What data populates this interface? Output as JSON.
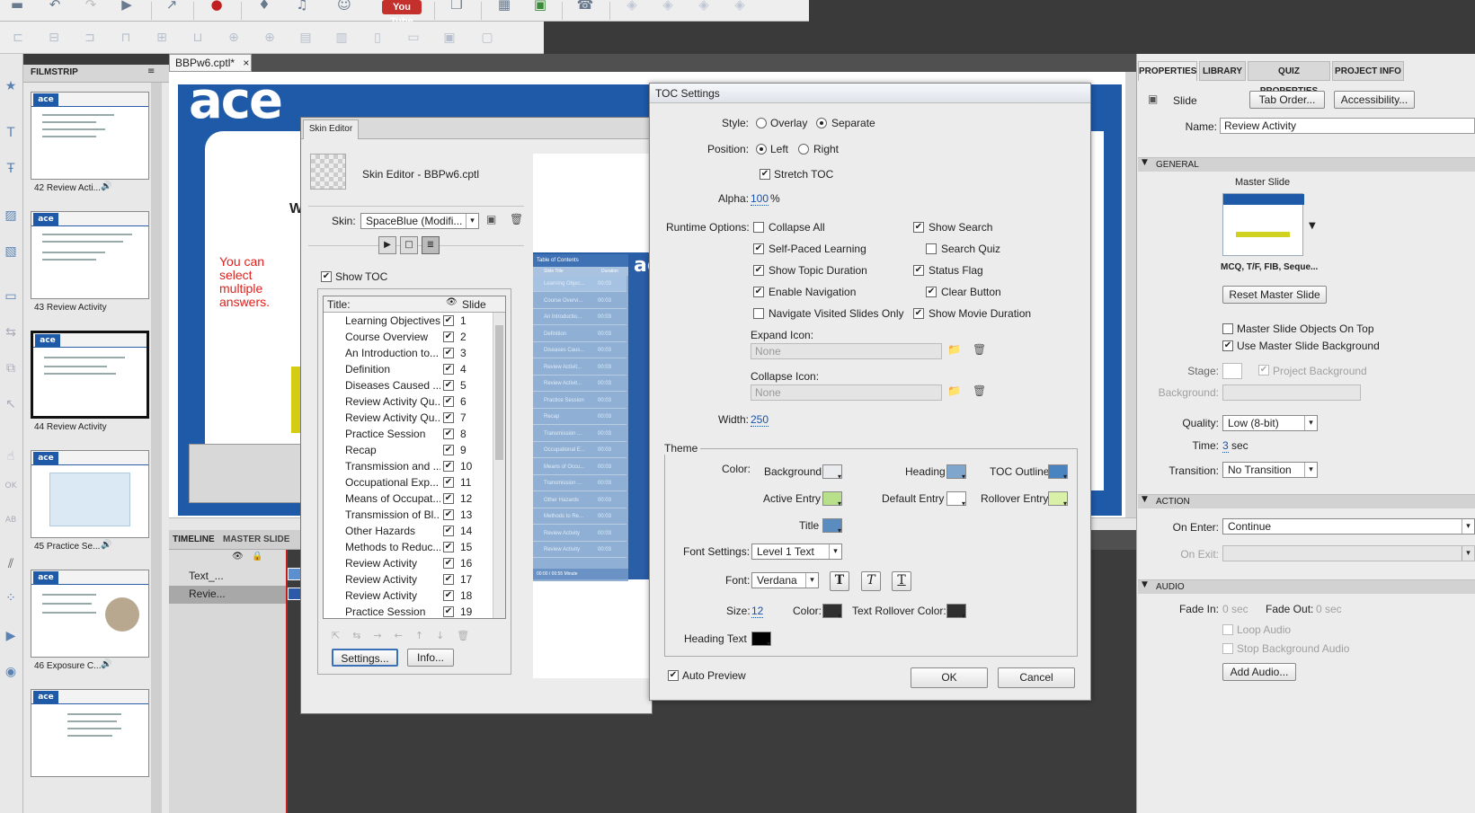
{
  "toolbar": {
    "youtube_label": "You Tube"
  },
  "document": {
    "tab_label": "BBPw6.cptl*",
    "tab_close": "×"
  },
  "filmstrip": {
    "header": "FILMSTRIP",
    "logo": "ace",
    "slides": [
      {
        "label": "42 Review Acti...",
        "audio": "🔊"
      },
      {
        "label": "43 Review Activity",
        "audio": ""
      },
      {
        "label": "44 Review Activity",
        "audio": ""
      },
      {
        "label": "45 Practice Se...",
        "audio": "🔊"
      },
      {
        "label": "46 Exposure C...",
        "audio": "🔊"
      }
    ]
  },
  "stage": {
    "logo": "ace",
    "side_text": "You can select multiple answers.",
    "partial_letter": "W"
  },
  "timeline": {
    "tabs": [
      "TIMELINE",
      "MASTER SLIDE"
    ],
    "rows": [
      "Text_...",
      "Revie..."
    ]
  },
  "skin_editor": {
    "tab": "Skin Editor",
    "title": "Skin Editor - BBPw6.cptl",
    "skin_label": "Skin:",
    "skin_value": "SpaceBlue (Modifi...",
    "show_toc": "Show TOC",
    "col_title": "Title:",
    "col_slide": "Slide",
    "rows": [
      {
        "title": "Learning Objectives",
        "slide": "1"
      },
      {
        "title": "Course Overview",
        "slide": "2"
      },
      {
        "title": "An Introduction to...",
        "slide": "3"
      },
      {
        "title": "Definition",
        "slide": "4"
      },
      {
        "title": "Diseases Caused ...",
        "slide": "5"
      },
      {
        "title": "Review Activity Qu...",
        "slide": "6"
      },
      {
        "title": "Review Activity Qu...",
        "slide": "7"
      },
      {
        "title": "Practice Session",
        "slide": "8"
      },
      {
        "title": "Recap",
        "slide": "9"
      },
      {
        "title": "Transmission and ...",
        "slide": "10"
      },
      {
        "title": "Occupational Exp...",
        "slide": "11"
      },
      {
        "title": "Means of Occupat...",
        "slide": "12"
      },
      {
        "title": "Transmission of Bl...",
        "slide": "13"
      },
      {
        "title": "Other Hazards",
        "slide": "14"
      },
      {
        "title": "Methods to Reduc...",
        "slide": "15"
      },
      {
        "title": "Review Activity",
        "slide": "16"
      },
      {
        "title": "Review Activity",
        "slide": "17"
      },
      {
        "title": "Review Activity",
        "slide": "18"
      },
      {
        "title": "Practice Session",
        "slide": "19"
      }
    ],
    "settings_button": "Settings...",
    "info_button": "Info..."
  },
  "preview": {
    "header": "Table of Contents",
    "col_title": "Slide Title",
    "col_duration": "Duration",
    "rows": [
      {
        "t": "Learning Objec...",
        "d": "00:03"
      },
      {
        "t": "Course Overvi...",
        "d": "00:03"
      },
      {
        "t": "An Introductio...",
        "d": "00:03"
      },
      {
        "t": "Definition",
        "d": "00:03"
      },
      {
        "t": "Diseases Caus...",
        "d": "00:03"
      },
      {
        "t": "Review Activit...",
        "d": "00:03"
      },
      {
        "t": "Review Activit...",
        "d": "00:03"
      },
      {
        "t": "Practice Session",
        "d": "00:03"
      },
      {
        "t": "Recap",
        "d": "00:03"
      },
      {
        "t": "Transmission ...",
        "d": "00:03"
      },
      {
        "t": "Occupational E...",
        "d": "00:03"
      },
      {
        "t": "Means of Occu...",
        "d": "00:03"
      },
      {
        "t": "Transmission ...",
        "d": "00:03"
      },
      {
        "t": "Other Hazards",
        "d": "00:03"
      },
      {
        "t": "Methods to Re...",
        "d": "00:03"
      },
      {
        "t": "Review Activity",
        "d": "00:03"
      },
      {
        "t": "Review Activity",
        "d": "00:03"
      }
    ],
    "footer": "00:00 / 00:55 Minute",
    "logo": "ac"
  },
  "toc_settings": {
    "title": "TOC Settings",
    "style_label": "Style:",
    "style_overlay": "Overlay",
    "style_separate": "Separate",
    "position_label": "Position:",
    "position_left": "Left",
    "position_right": "Right",
    "stretch_toc": "Stretch TOC",
    "alpha_label": "Alpha:",
    "alpha_value": "100",
    "alpha_unit": "%",
    "runtime_label": "Runtime Options:",
    "opt_collapse_all": "Collapse All",
    "opt_self_paced": "Self-Paced Learning",
    "opt_topic_duration": "Show Topic Duration",
    "opt_enable_nav": "Enable Navigation",
    "opt_nav_visited": "Navigate Visited Slides Only",
    "opt_show_search": "Show Search",
    "opt_search_quiz": "Search Quiz",
    "opt_status_flag": "Status Flag",
    "opt_clear_button": "Clear Button",
    "opt_movie_duration": "Show Movie Duration",
    "expand_icon_label": "Expand Icon:",
    "expand_icon_value": "None",
    "collapse_icon_label": "Collapse Icon:",
    "collapse_icon_value": "None",
    "width_label": "Width:",
    "width_value": "250",
    "theme_label": "Theme",
    "color_label": "Color:",
    "c_background": "Background",
    "c_heading": "Heading",
    "c_toc_outline": "TOC Outline",
    "c_active_entry": "Active Entry",
    "c_default_entry": "Default Entry",
    "c_rollover_entry": "Rollover Entry",
    "c_title": "Title",
    "font_settings_label": "Font Settings:",
    "font_settings_value": "Level 1 Text",
    "font_label": "Font:",
    "font_value": "Verdana",
    "size_label": "Size:",
    "size_value": "12",
    "font_color_label": "Color:",
    "text_rollover_label": "Text Rollover Color:",
    "heading_text_label": "Heading Text",
    "auto_preview": "Auto Preview",
    "ok": "OK",
    "cancel": "Cancel",
    "style_b": "T",
    "style_i": "T",
    "style_u": "T"
  },
  "colors": {
    "background": "#e9ebee",
    "heading": "#7fa6cc",
    "toc_outline": "#4a84c0",
    "active_entry": "#b8e08a",
    "default_entry": "#ffffff",
    "rollover_entry": "#d8f0a8",
    "title": "#5b8cc0",
    "font_color": "#303030",
    "text_rollover": "#303030",
    "heading_text": "#000000",
    "brand_blue": "#1e5aa8"
  },
  "properties": {
    "tabs": [
      "PROPERTIES",
      "LIBRARY",
      "QUIZ PROPERTIES",
      "PROJECT INFO"
    ],
    "slide_label": "Slide",
    "tab_order_button": "Tab Order...",
    "accessibility_button": "Accessibility...",
    "name_label": "Name:",
    "name_value": "Review Activity",
    "general_header": "GENERAL",
    "master_slide_label": "Master Slide",
    "master_slide_name": "MCQ, T/F, FIB, Seque...",
    "reset_master_button": "Reset Master Slide",
    "master_objects_on_top": "Master Slide Objects On Top",
    "use_master_background": "Use Master Slide Background",
    "stage_label": "Stage:",
    "project_background": "Project Background",
    "background_label": "Background:",
    "quality_label": "Quality:",
    "quality_value": "Low (8-bit)",
    "time_label": "Time:",
    "time_value": "3",
    "time_unit": "sec",
    "transition_label": "Transition:",
    "transition_value": "No Transition",
    "action_header": "ACTION",
    "on_enter_label": "On Enter:",
    "on_enter_value": "Continue",
    "on_exit_label": "On Exit:",
    "audio_header": "AUDIO",
    "fade_in_label": "Fade In:",
    "fade_in_value": "0 sec",
    "fade_out_label": "Fade Out:",
    "fade_out_value": "0 sec",
    "loop_audio": "Loop Audio",
    "stop_bg_audio": "Stop Background Audio",
    "add_audio_button": "Add Audio..."
  }
}
